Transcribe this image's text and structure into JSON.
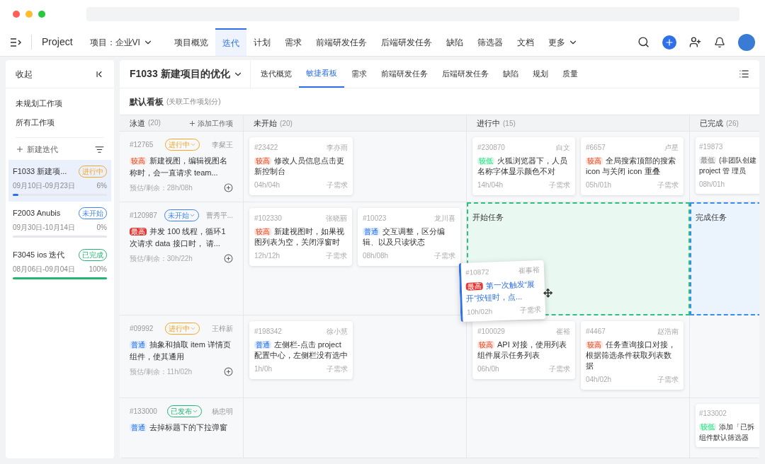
{
  "nav": {
    "brand": "Project",
    "project": "项目：企业VI",
    "more": "更多",
    "tabs": [
      {
        "label": "项目概览",
        "selected": false
      },
      {
        "label": "迭代",
        "selected": true
      },
      {
        "label": "计划",
        "selected": false
      },
      {
        "label": "需求",
        "selected": false
      },
      {
        "label": "前端研发任务",
        "selected": false
      },
      {
        "label": "后端研发任务",
        "selected": false
      },
      {
        "label": "缺陷",
        "selected": false
      },
      {
        "label": "筛选器",
        "selected": false
      },
      {
        "label": "文档",
        "selected": false
      }
    ]
  },
  "sidebar": {
    "collapse": "收起",
    "links": [
      "未规划工作项",
      "所有工作项"
    ],
    "new_iteration": "新建迭代",
    "iterations": [
      {
        "name": "F1033 新建项...",
        "status": {
          "label": "进行中",
          "color": "#f5a623"
        },
        "dates": "09月10日-09月23日",
        "progress": {
          "percent": "6%",
          "level": 0.06,
          "color": "#2f6fe8"
        },
        "selected": true
      },
      {
        "name": "F2003 Anubis",
        "status": {
          "label": "未开始",
          "color": "#3b82f6"
        },
        "dates": "09月30日-10月14日",
        "progress": {
          "percent": "0%"
        },
        "selected": false
      },
      {
        "name": "F3045 ios 迭代",
        "status": {
          "label": "已完成",
          "color": "#22b573"
        },
        "dates": "08月06日-09月04日",
        "progress": {
          "percent": "100%",
          "level": 1,
          "color": "#22b573"
        },
        "selected": false
      }
    ]
  },
  "iteration": {
    "title": "F1033 新建项目的优化",
    "tabs": [
      {
        "label": "迭代概览",
        "selected": false
      },
      {
        "label": "敏捷看板",
        "selected": true
      },
      {
        "label": "需求",
        "selected": false
      },
      {
        "label": "前端研发任务",
        "selected": false
      },
      {
        "label": "后端研发任务",
        "selected": false
      },
      {
        "label": "缺陷",
        "selected": false
      },
      {
        "label": "规划",
        "selected": false
      },
      {
        "label": "质量",
        "selected": false
      }
    ]
  },
  "board": {
    "title": "默认看板",
    "subtitle": "(关联工作项划分)",
    "lane_header": {
      "label": "泳道",
      "count": "(20)",
      "add": "添加工作项"
    },
    "columns": [
      {
        "label": "未开始",
        "count": "(20)"
      },
      {
        "label": "进行中",
        "count": "(15)"
      },
      {
        "label": "已完成",
        "count": "(26)"
      }
    ],
    "lanes": [
      {
        "story": {
          "id": "#12765",
          "status": {
            "label": "进行中",
            "color": "#f5a623"
          },
          "owner": "李粲王",
          "priority": {
            "label": "较高",
            "color": "#fde5df",
            "solid": false
          },
          "title": "新建视图，编辑视图名称时，会一直请求 team...",
          "estimate": "预估/剩余：28h/08h"
        },
        "cells": [
          {
            "cards": [
              {
                "id": "#23422",
                "owner": "李亦雨",
                "priority": {
                  "label": "较高",
                  "color": "#fde5df",
                  "solid": false
                },
                "title": "修改人员信息点击更新控制台",
                "estimate": "04h/04h",
                "type": "子需求"
              }
            ]
          },
          {
            "cards": [
              {
                "id": "#230870",
                "owner": "白文",
                "priority": {
                  "label": "较低",
                  "color": "#dff5ea",
                  "solid": false
                },
                "title": "火狐浏览器下，人员名称字体显示颜色不对",
                "estimate": "14h/04h",
                "type": "子需求"
              },
              {
                "id": "#6657",
                "owner": "卢星",
                "priority": {
                  "label": "较高",
                  "color": "#fde5df",
                  "solid": false
                },
                "title": "全局搜索顶部的搜索 icon 与关闭 icon 重叠",
                "estimate": "05h/01h",
                "type": "子需求"
              }
            ]
          },
          {
            "cards": [
              {
                "id": "#19873",
                "priority": {
                  "label": "最低",
                  "color": "#eeeeee",
                  "solid": false
                },
                "title": "(非团队创建 project 管 理员",
                "estimate": "08h/01h"
              }
            ]
          }
        ]
      },
      {
        "story": {
          "id": "#120987",
          "status": {
            "label": "未开始",
            "color": "#3b82f6"
          },
          "owner": "曹秀平...",
          "priority": {
            "label": "最高",
            "color": "#e53935",
            "solid": true
          },
          "title": "并发 100 线程，循环1次请求 data 接口时， 请...",
          "estimate": "预估/剩余：30h/22h"
        },
        "cells": [
          {
            "cards": [
              {
                "id": "#102330",
                "owner": "张晓丽",
                "priority": {
                  "label": "较高",
                  "color": "#fde5df",
                  "solid": false
                },
                "title": "新建视图时，如果视图列表为空，关闭浮窗时",
                "estimate": "12h/12h",
                "type": "子需求"
              },
              {
                "id": "#10023",
                "owner": "龙川喜",
                "priority": {
                  "label": "普通",
                  "color": "#e1ecfd",
                  "solid": false
                },
                "title": "交互调整，区分编辑、以及只读状态",
                "estimate": "08h/08h",
                "type": "子需求"
              }
            ]
          },
          {
            "drop": {
              "label": "开始任务",
              "color": "#2fbf7f"
            }
          },
          {
            "drop": {
              "label": "完成任务",
              "color": "#3b8bf0"
            }
          }
        ]
      },
      {
        "story": {
          "id": "#09992",
          "status": {
            "label": "进行中",
            "color": "#f5a623"
          },
          "owner": "王梓新",
          "priority": {
            "label": "普通",
            "color": "#e1ecfd",
            "solid": false
          },
          "title": "抽象和抽取 item 详情页组件，使其通用",
          "estimate": "预估/剩余：11h/02h"
        },
        "cells": [
          {
            "cards": [
              {
                "id": "#198342",
                "owner": "徐小慧",
                "priority": {
                  "label": "普通",
                  "color": "#e1ecfd",
                  "solid": false
                },
                "title": "左侧栏-点击 project 配置中心，左侧栏没有选中",
                "estimate": "1h/0h",
                "type": "子需求"
              }
            ]
          },
          {
            "cards": [
              {
                "id": "#100029",
                "owner": "崔裕",
                "priority": {
                  "label": "较高",
                  "color": "#fde5df",
                  "solid": false
                },
                "title": "API 对接，使用列表组件展示任务列表",
                "estimate": "06h/0h",
                "type": "子需求"
              },
              {
                "id": "#4467",
                "owner": "赵浩南",
                "priority": {
                  "label": "较高",
                  "color": "#fde5df",
                  "solid": false
                },
                "title": "任务查询接口对接，根据筛选条件获取列表数据",
                "estimate": "04h/02h",
                "type": "子需求"
              }
            ]
          },
          {}
        ]
      },
      {
        "story": {
          "id": "#133000",
          "status": {
            "label": "已发布",
            "color": "#22b573"
          },
          "owner": "杨忠明",
          "priority": {
            "label": "普通",
            "color": "#e1ecfd",
            "solid": false
          },
          "title": "去掉标题下的下拉弹窗"
        },
        "cells": [
          {},
          {},
          {
            "cards": [
              {
                "id": "#133002",
                "priority": {
                  "label": "较低",
                  "color": "#dff5ea",
                  "solid": false
                },
                "title": "添加「已拆组件默认筛选器"
              }
            ]
          }
        ]
      }
    ],
    "dragging": {
      "id": "#10872",
      "owner": "崔事裕",
      "priority": {
        "label": "最高",
        "color": "#e53935",
        "solid": true
      },
      "title": "第一次触发“展开”按钮时，点...",
      "estimate": "10h/02h",
      "type": "子需求"
    }
  }
}
